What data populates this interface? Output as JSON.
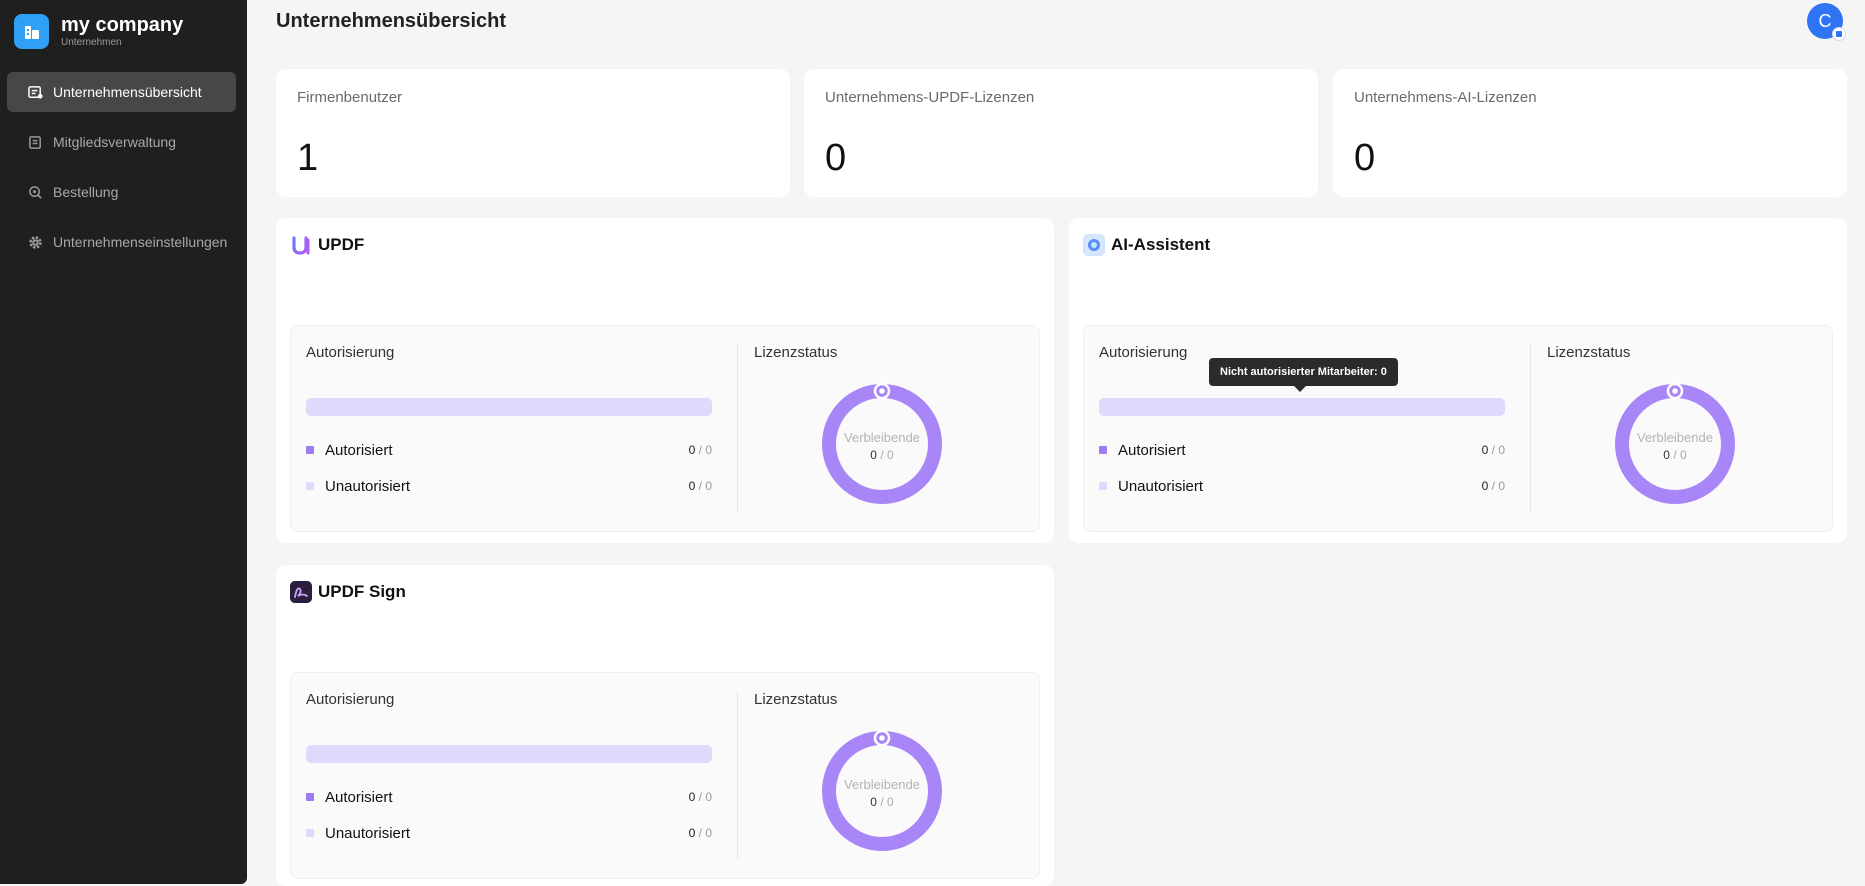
{
  "sidebar": {
    "brand_name": "my company",
    "brand_sub": "Unternehmen",
    "items": [
      {
        "label": "Unternehmensübersicht",
        "icon": "overview-icon",
        "active": true
      },
      {
        "label": "Mitgliedsverwaltung",
        "icon": "members-icon",
        "active": false
      },
      {
        "label": "Bestellung",
        "icon": "order-icon",
        "active": false
      },
      {
        "label": "Unternehmenseinstellungen",
        "icon": "gear-icon",
        "active": false
      }
    ]
  },
  "header": {
    "title": "Unternehmensübersicht",
    "avatar_letter": "C"
  },
  "stats": [
    {
      "label": "Firmenbenutzer",
      "value": "1"
    },
    {
      "label": "Unternehmens-UPDF-Lizenzen",
      "value": "0"
    },
    {
      "label": "Unternehmens-AI-Lizenzen",
      "value": "0"
    }
  ],
  "products": [
    {
      "name": "UPDF",
      "icon": "updf-logo-icon",
      "auth_title": "Autorisierung",
      "authorized_label": "Autorisiert",
      "authorized_count": "0",
      "authorized_total": "0",
      "unauthorized_label": "Unautorisiert",
      "unauthorized_count": "0",
      "unauthorized_total": "0",
      "license_title": "Lizenzstatus",
      "remaining_label": "Verbleibende",
      "remaining_count": "0",
      "remaining_total": "0"
    },
    {
      "name": "AI-Assistent",
      "icon": "ai-assistant-icon",
      "auth_title": "Autorisierung",
      "authorized_label": "Autorisiert",
      "authorized_count": "0",
      "authorized_total": "0",
      "unauthorized_label": "Unautorisiert",
      "unauthorized_count": "0",
      "unauthorized_total": "0",
      "license_title": "Lizenzstatus",
      "remaining_label": "Verbleibende",
      "remaining_count": "0",
      "remaining_total": "0"
    },
    {
      "name": "UPDF Sign",
      "icon": "updf-sign-icon",
      "auth_title": "Autorisierung",
      "authorized_label": "Autorisiert",
      "authorized_count": "0",
      "authorized_total": "0",
      "unauthorized_label": "Unautorisiert",
      "unauthorized_count": "0",
      "unauthorized_total": "0",
      "license_title": "Lizenzstatus",
      "remaining_label": "Verbleibende",
      "remaining_count": "0",
      "remaining_total": "0"
    }
  ],
  "tooltip": "Nicht autorisierter Mitarbeiter: 0",
  "colors": {
    "authorized": "#9d7cf3",
    "unauthorized": "#e0d9fb",
    "donut": "#a886f7",
    "sidebar_bg": "#1f1f1f",
    "avatar": "#2e74f3"
  }
}
